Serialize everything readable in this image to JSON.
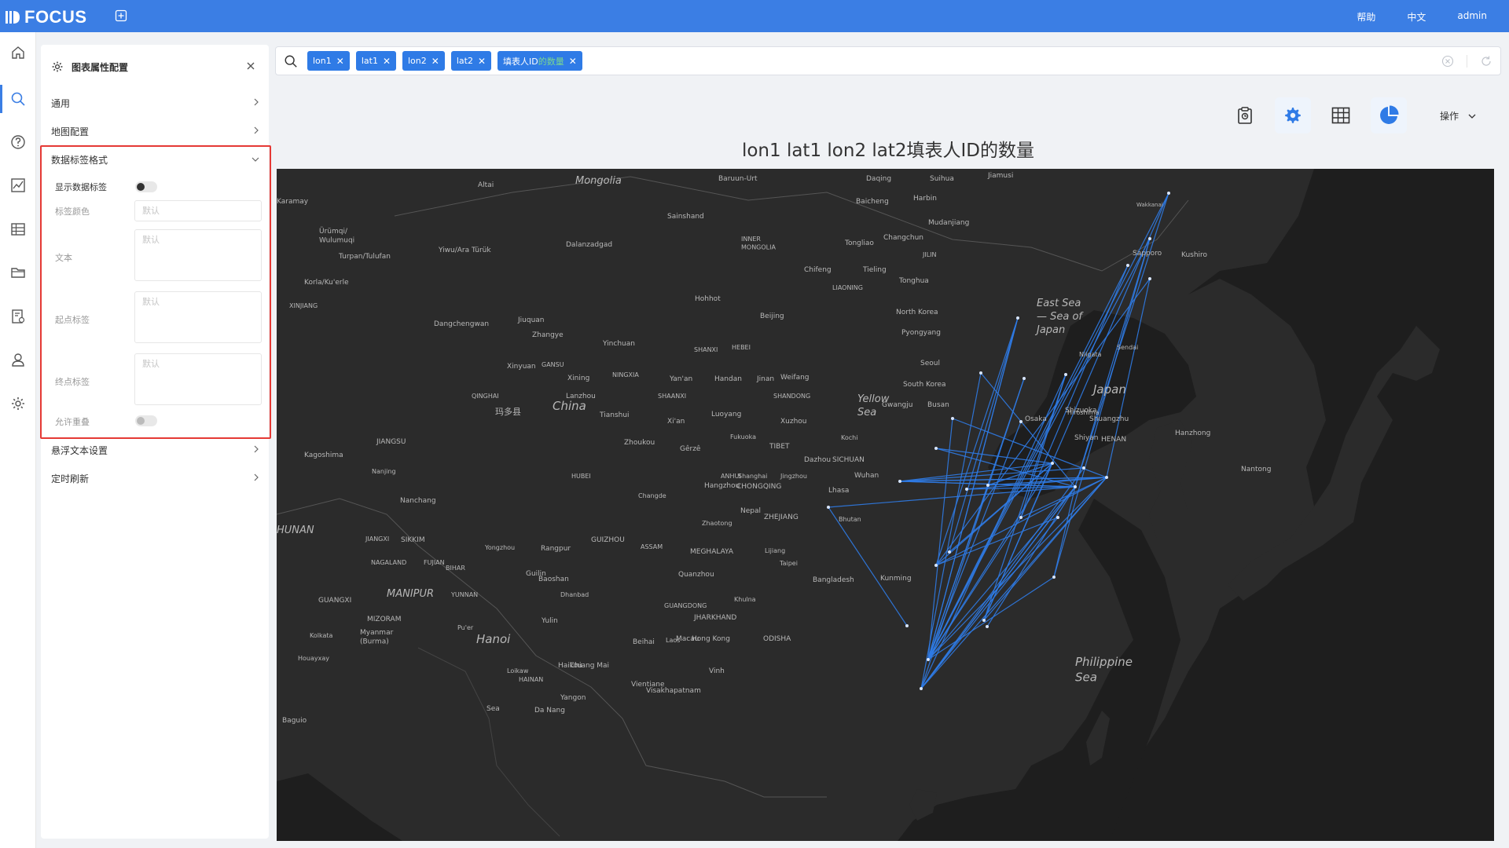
{
  "app": {
    "logo": "FOCUS",
    "links": [
      "帮助",
      "中文",
      "admin"
    ]
  },
  "panel": {
    "title": "图表属性配置",
    "sections": [
      "通用",
      "地图配置",
      "数据标签格式",
      "悬浮文本设置",
      "定时刷新"
    ],
    "label_format": {
      "show_label": "显示数据标签",
      "label_color": "标签颜色",
      "label_color_placeholder": "默认",
      "text": "文本",
      "text_placeholder": "默认",
      "start_label": "起点标签",
      "start_placeholder": "默认",
      "end_label": "终点标签",
      "end_placeholder": "默认",
      "allow_overlap": "允许重叠"
    }
  },
  "search": {
    "chips": [
      "lon1",
      "lat1",
      "lon2",
      "lat2"
    ],
    "chip_last_prefix": "填表人ID",
    "chip_last_suffix": "的数量"
  },
  "toolbar": {
    "ops": "操作"
  },
  "chart_title": "lon1 lat1 lon2 lat2填表人ID的数量",
  "colors": {
    "accent": "#3b7ee4",
    "chip": "#2f7be6",
    "flow_line": "#2f7be6",
    "map_bg": "#2b2b2b",
    "highlight": "#e53935"
  },
  "map_labels": {
    "places": [
      "Mongolia",
      "Baruun-Urt",
      "Daqing",
      "Suihua",
      "Jiamusi",
      "Altai",
      "Karamay",
      "Harbin",
      "Baicheng",
      "Mudanjiang",
      "Wakkanai",
      "Sainshand",
      "Ürümqi/\nWulumuqi",
      "Changchun",
      "Dalanzadgad",
      "Tongliao",
      "Yiwu/Ara Türük",
      "INNER\nMONGOLIA",
      "Turpan/Tulufan",
      "Chifeng",
      "Tieling",
      "JILIN",
      "Sapporo",
      "Kushiro",
      "Korla/Ku'erle",
      "Tonghua",
      "LIAONING",
      "XINJIANG",
      "Hohhot",
      "East Sea\n— Sea of\nJapan",
      "North Korea",
      "Beijing",
      "Dangchengwan",
      "Jiuquan",
      "Pyongyang",
      "Zhangye",
      "Yinchuan",
      "SHANXI",
      "HEBEI",
      "Seoul",
      "Sendai",
      "Niigata",
      "GANSU",
      "Xinyuan",
      "Xining",
      "NINGXIA",
      "Yan'an",
      "Handan",
      "Jinan",
      "Weifang",
      "South Korea",
      "Japan",
      "QINGHAI",
      "Lanzhou",
      "SHAANXI",
      "SHANDONG",
      "Yellow\nSea",
      "China",
      "玛多县",
      "Tianshui",
      "Xi'an",
      "Luoyang",
      "Xuzhou",
      "Gwangju",
      "Busan",
      "Shizuoka",
      "Hiroshima",
      "Osaka",
      "Shuangzhu",
      "HENAN",
      "JIANGSU",
      "Fukuoka",
      "Kochi",
      "Hanzhong",
      "Shiyan",
      "Zhoukou",
      "Gêrzê",
      "TIBET",
      "Kagoshima",
      "Nanjing",
      "Nantong",
      "Dazhou",
      "SICHUAN",
      "HUBEI",
      "ANHUI",
      "Shanghai",
      "Jingzhou",
      "Wuhan",
      "Hangzhou",
      "CHONGQING",
      "Lhasa",
      "Changde",
      "Nanchang",
      "Nepal",
      "ZHEJIANG",
      "HUNAN",
      "Bhutan",
      "Zhaotong",
      "SIKKIM",
      "GUIZHOU",
      "JIANGXI",
      "ASSAM",
      "Lijiang",
      "Yongzhou",
      "Rangpur",
      "MEGHALAYA",
      "NAGALAND",
      "FUJIAN",
      "BIHAR",
      "Taipei",
      "Kunming",
      "Baoshan",
      "Guilin",
      "Quanzhou",
      "Bangladesh",
      "MANIPUR",
      "YUNNAN",
      "Dhanbad",
      "GUANGXI",
      "GUANGDONG",
      "Khulna",
      "MIZORAM",
      "Pu'er",
      "Yulin",
      "JHARKHAND",
      "Kolkata",
      "Myanmar\n(Burma)",
      "Hanoi",
      "Beihai",
      "Macau",
      "Hong Kong",
      "ODISHA",
      "Houayxay",
      "Haikou",
      "Laos",
      "Philippine\nSea",
      "Loikaw",
      "Chiang Mai",
      "Vinh",
      "HAINAN",
      "Vientiane",
      "Visakhapatnam",
      "Yangon",
      "Baguio",
      "Da Nang",
      "Sea"
    ]
  }
}
